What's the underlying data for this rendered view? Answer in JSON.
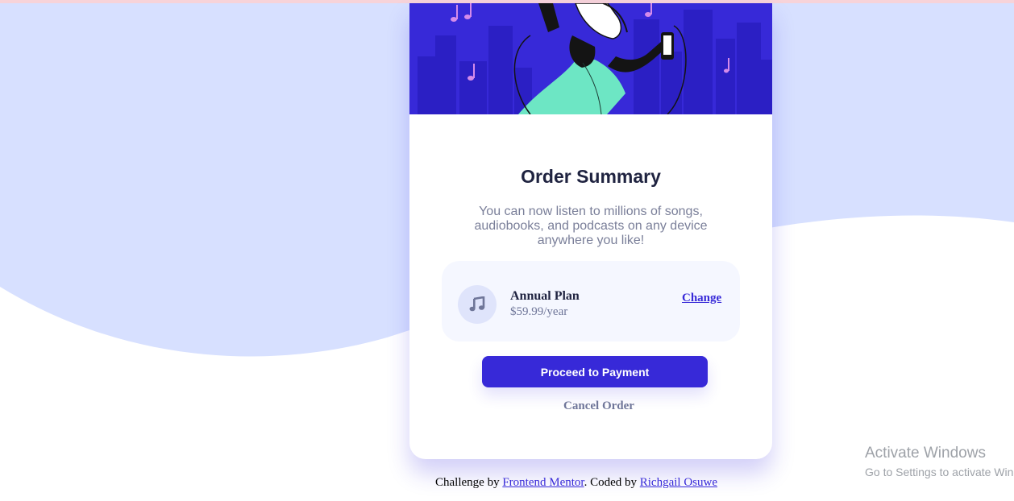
{
  "colors": {
    "page_background": "#d7e0ff",
    "hero_background": "#3729d8",
    "primary": "#3729d8",
    "title_text": "#1f2340",
    "muted_text": "#7a7f99",
    "plan_box": "#f5f7ff",
    "icon_circle": "#dfe4fb"
  },
  "hero": {
    "illustration": "person-dancing-with-headphones-illustration"
  },
  "order_summary": {
    "title": "Order Summary",
    "description": "You can now listen to millions of songs, audiobooks, and podcasts on any device anywhere you like!",
    "plan": {
      "icon": "music-note-icon",
      "name": "Annual Plan",
      "price": "$59.99/year",
      "change_label": "Change"
    },
    "proceed_label": "Proceed to Payment",
    "cancel_label": "Cancel Order"
  },
  "attribution": {
    "prefix": "Challenge by ",
    "frontend_mentor": "Frontend Mentor",
    "middle": ". Coded by ",
    "author": "Richgail Osuwe"
  },
  "watermark": {
    "title": "Activate Windows",
    "subtitle": "Go to Settings to activate Windows."
  }
}
